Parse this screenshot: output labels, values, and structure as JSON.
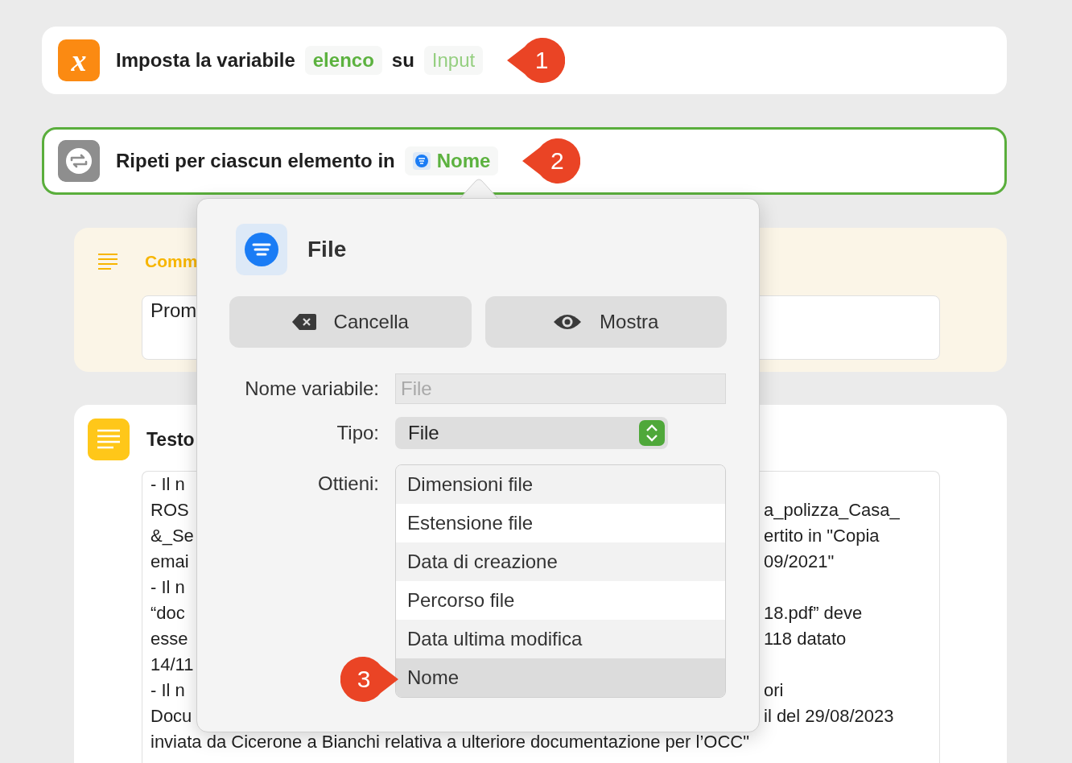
{
  "actions": [
    {
      "kind": "set_variable",
      "icon_char": "x",
      "selected": false,
      "callout": "1",
      "parts": [
        {
          "kind": "text",
          "text": "Imposta la variabile"
        },
        {
          "kind": "token",
          "text": "elenco",
          "dim": false
        },
        {
          "kind": "text",
          "text": "su"
        },
        {
          "kind": "token",
          "text": "Input",
          "dim": true
        }
      ]
    },
    {
      "kind": "repeat",
      "selected": true,
      "callout": "2",
      "parts": [
        {
          "kind": "text",
          "text": "Ripeti per ciascun elemento in"
        },
        {
          "kind": "token",
          "text": "Nome",
          "dim": false,
          "icon": true
        }
      ]
    }
  ],
  "comment": {
    "title": "Comm",
    "field_text": "Prom"
  },
  "text_action": {
    "title": "Testo",
    "lines": [
      {
        "left": "- Il n"
      },
      {
        "left": "ROS",
        "right": "a_polizza_Casa_"
      },
      {
        "left": "&_Se",
        "right": "ertito in \"Copia"
      },
      {
        "left": "emai",
        "right": "09/2021\""
      },
      {
        "left": "- Il n"
      },
      {
        "left": "“doc",
        "right": "18.pdf” deve"
      },
      {
        "left": "esse",
        "right": "118 datato"
      },
      {
        "left": "14/11"
      },
      {
        "left": "- Il n",
        "right": "ori"
      },
      {
        "left": "Docu",
        "right": "il del 29/08/2023"
      },
      {
        "left": "inviata da Cicerone a Bianchi relativa a ulteriore documentazione per l’OCC\""
      }
    ]
  },
  "popover": {
    "title": "File",
    "callout": "3",
    "buttons": [
      {
        "kind": "clear",
        "label": "Cancella"
      },
      {
        "kind": "show",
        "label": "Mostra"
      }
    ],
    "variable_name": {
      "label": "Nome variabile:",
      "placeholder": "File"
    },
    "type": {
      "label": "Tipo:",
      "value": "File"
    },
    "get": {
      "label": "Ottieni:",
      "options": [
        {
          "label": "Dimensioni file",
          "selected": false
        },
        {
          "label": "Estensione file",
          "selected": false
        },
        {
          "label": "Data di creazione",
          "selected": false
        },
        {
          "label": "Percorso file",
          "selected": false
        },
        {
          "label": "Data ultima modifica",
          "selected": false
        },
        {
          "label": "Nome",
          "selected": true
        }
      ]
    }
  }
}
